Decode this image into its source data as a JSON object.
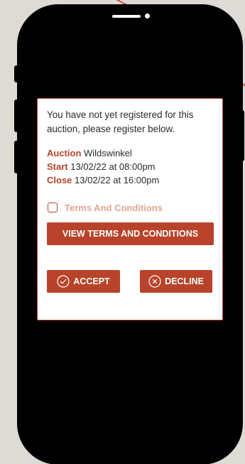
{
  "dialog": {
    "message": "You have not yet registered for this auction, please register below.",
    "auction_label": "Auction",
    "auction_value": "Wildswinkel",
    "start_label": "Start",
    "start_value": "13/02/22 at 08:00pm",
    "close_label": "Close",
    "close_value": "13/02/22 at 16:00pm",
    "terms_label": "Terms And Conditions",
    "terms_checked": false,
    "view_terms_label": "VIEW TERMS AND CONDITIONS",
    "accept_label": "ACCEPT",
    "decline_label": "DECLINE"
  },
  "colors": {
    "accent": "#b8432a",
    "terms_text": "#e0a694",
    "background": "#dedbd5",
    "phone": "#000000"
  },
  "icons": {
    "accept": "check-circle-icon",
    "decline": "x-circle-icon"
  }
}
